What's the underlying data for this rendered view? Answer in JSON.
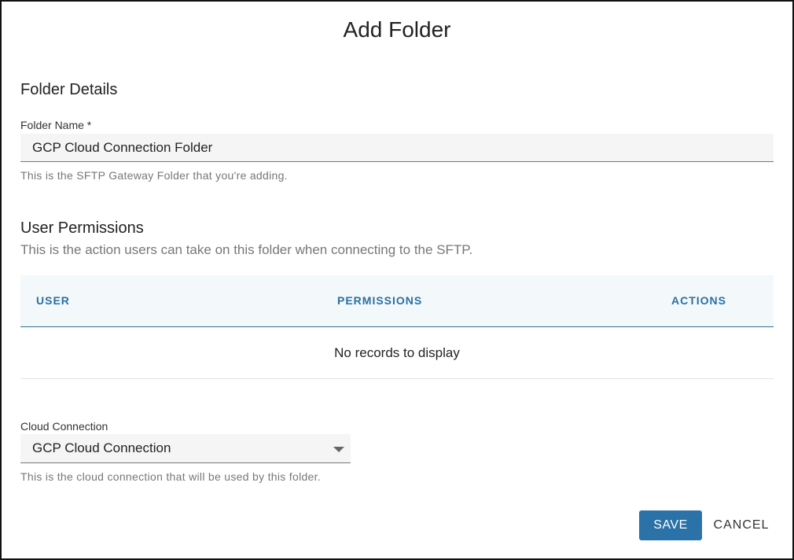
{
  "dialog": {
    "title": "Add Folder"
  },
  "folder_details": {
    "heading": "Folder Details",
    "name_label": "Folder Name *",
    "name_value": "GCP Cloud Connection Folder",
    "name_helper": "This is the SFTP Gateway Folder that you're adding."
  },
  "user_permissions": {
    "heading": "User Permissions",
    "subheading": "This is the action users can take on this folder when connecting to the SFTP.",
    "columns": [
      "USER",
      "PERMISSIONS",
      "ACTIONS"
    ],
    "empty_message": "No records to display"
  },
  "cloud_connection": {
    "label": "Cloud Connection",
    "selected": "GCP Cloud Connection",
    "helper": "This is the cloud connection that will be used by this folder."
  },
  "actions": {
    "save_label": "SAVE",
    "cancel_label": "CANCEL"
  },
  "colors": {
    "accent": "#2a72a8",
    "table_header_text": "#2a70a0",
    "table_header_bg": "#f3f8fb"
  },
  "icons": {
    "select_caret": "caret-down-icon"
  }
}
